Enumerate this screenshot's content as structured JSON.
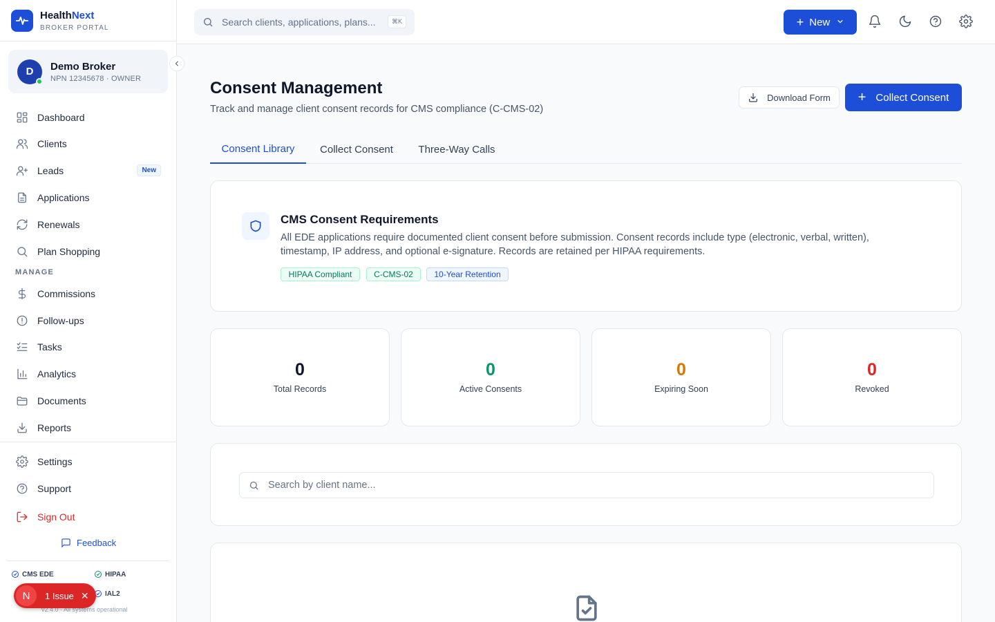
{
  "brand": {
    "name_part1": "Health",
    "name_part2": "Next",
    "subtitle": "BROKER PORTAL"
  },
  "profile": {
    "initial": "D",
    "name": "Demo Broker",
    "meta": "NPN 12345678 · OWNER"
  },
  "nav": {
    "items": [
      {
        "label": "Dashboard",
        "icon": "dashboard-icon"
      },
      {
        "label": "Clients",
        "icon": "users-icon"
      },
      {
        "label": "Leads",
        "icon": "user-plus-icon",
        "badge": "New"
      },
      {
        "label": "Applications",
        "icon": "file-text-icon"
      },
      {
        "label": "Renewals",
        "icon": "refresh-icon"
      },
      {
        "label": "Plan Shopping",
        "icon": "search-icon"
      }
    ],
    "manage_label": "MANAGE",
    "manage_items": [
      {
        "label": "Commissions",
        "icon": "dollar-icon"
      },
      {
        "label": "Follow-ups",
        "icon": "alert-circle-icon"
      },
      {
        "label": "Tasks",
        "icon": "list-checks-icon"
      },
      {
        "label": "Analytics",
        "icon": "bar-chart-icon"
      },
      {
        "label": "Documents",
        "icon": "folder-icon"
      },
      {
        "label": "Reports",
        "icon": "download-icon"
      }
    ],
    "bottom_items": [
      {
        "label": "Settings",
        "icon": "gear-icon"
      },
      {
        "label": "Support",
        "icon": "help-circle-icon"
      },
      {
        "label": "Sign Out",
        "icon": "logout-icon"
      }
    ],
    "feedback": "Feedback"
  },
  "compliance": [
    "CMS EDE",
    "HIPAA",
    "IAL2"
  ],
  "version": "v2.4.0 · All systems operational",
  "issue": {
    "initial": "N",
    "label": "1 Issue"
  },
  "topbar": {
    "search_placeholder": "Search clients, applications, plans...",
    "shortcut": "⌘K",
    "new_label": "New"
  },
  "page": {
    "title": "Consent Management",
    "subtitle": "Track and manage client consent records for CMS compliance (C-CMS-02)",
    "download_label": "Download Form",
    "collect_label": "Collect Consent"
  },
  "tabs": [
    "Consent Library",
    "Collect Consent",
    "Three-Way Calls"
  ],
  "requirements": {
    "title": "CMS Consent Requirements",
    "description": "All EDE applications require documented client consent before submission. Consent records include type (electronic, verbal, written), timestamp, IP address, and optional e-signature. Records are retained per HIPAA requirements.",
    "tags": [
      "HIPAA Compliant",
      "C-CMS-02",
      "10-Year Retention"
    ]
  },
  "stats": [
    {
      "value": "0",
      "label": "Total Records",
      "color": "#0f172a"
    },
    {
      "value": "0",
      "label": "Active Consents",
      "color": "#059669"
    },
    {
      "value": "0",
      "label": "Expiring Soon",
      "color": "#d97706"
    },
    {
      "value": "0",
      "label": "Revoked",
      "color": "#dc2626"
    }
  ],
  "client_search": {
    "placeholder": "Search by client name...",
    "value": ""
  },
  "colors": {
    "primary": "#1d4ed8",
    "danger": "#dc2626",
    "success": "#059669",
    "warning": "#d97706"
  }
}
